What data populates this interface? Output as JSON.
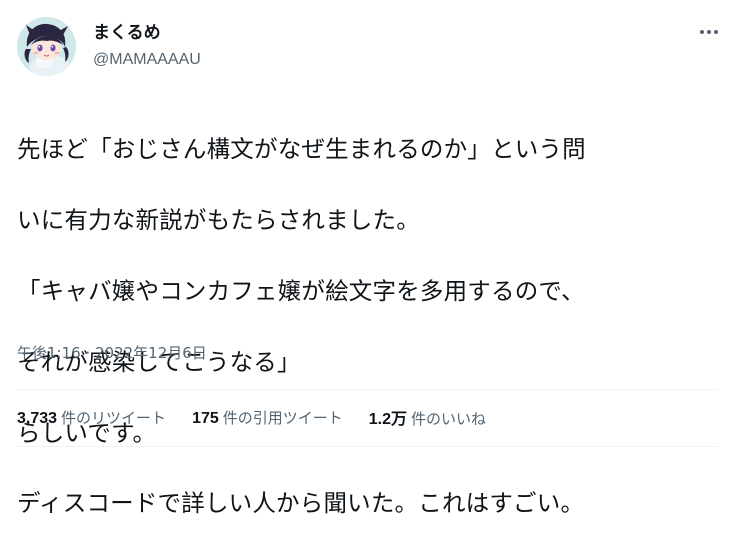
{
  "user": {
    "display_name": "まくるめ",
    "handle": "@MAMAAAAU",
    "avatar_icon": "anime-character-avatar"
  },
  "more_icon": "more-dots-icon",
  "tweet": {
    "text_lines": [
      "先ほど「おじさん構文がなぜ生まれるのか」という問",
      "いに有力な新説がもたらされました。",
      "「キャバ嬢やコンカフェ嬢が絵文字を多用するので、",
      "それが感染してこうなる」",
      "らしいです。",
      "ディスコードで詳しい人から聞いた。これはすごい。"
    ],
    "timestamp": "午後1:16 · 2022年12月6日"
  },
  "stats": [
    {
      "count": "3,733",
      "label": "件のリツイート"
    },
    {
      "count": "175",
      "label": "件の引用ツイート"
    },
    {
      "count": "1.2万",
      "label": "件のいいね"
    }
  ],
  "colors": {
    "text": "#0f1419",
    "secondary": "#536471",
    "divider": "#eff3f4",
    "background": "#ffffff"
  }
}
